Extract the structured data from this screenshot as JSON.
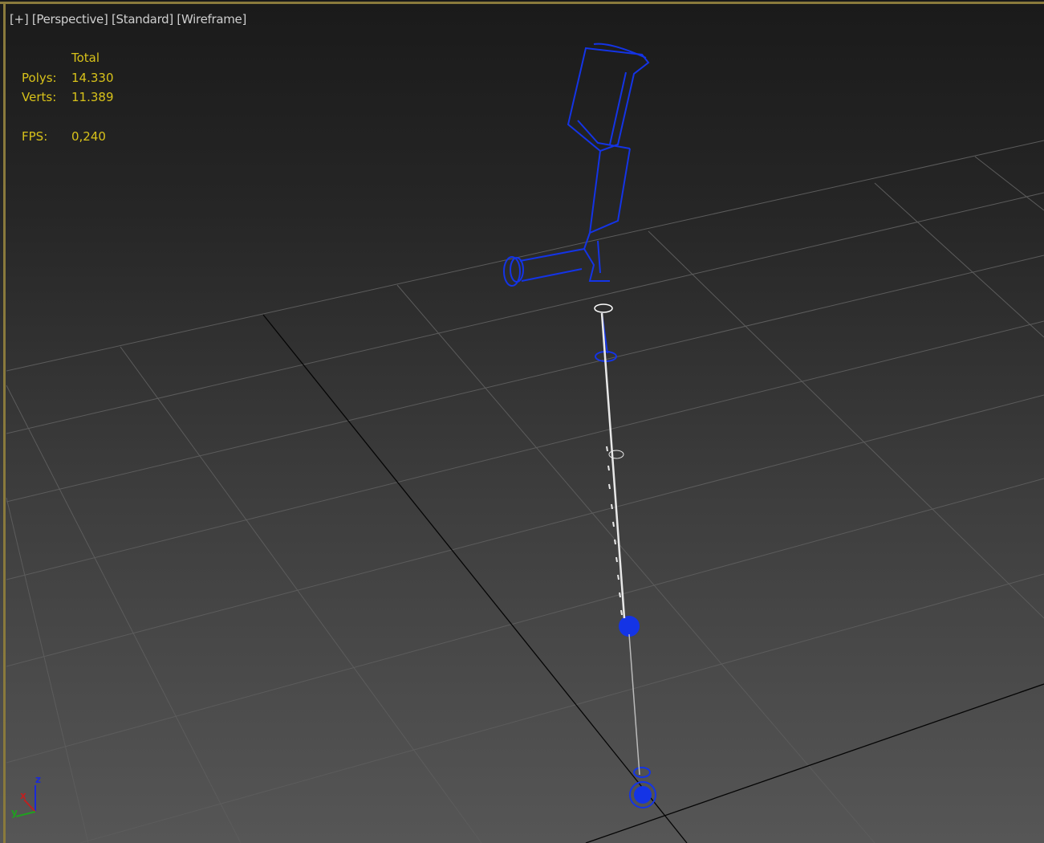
{
  "viewport": {
    "labels": [
      "[+]",
      "[Perspective]",
      "[Standard]",
      "[Wireframe]"
    ],
    "stats": {
      "header": "Total",
      "polys_label": "Polys:",
      "polys_value": "14.330",
      "verts_label": "Verts:",
      "verts_value": "11.389",
      "fps_label": "FPS:",
      "fps_value": "0,240"
    },
    "axis_gizmo": {
      "x": "x",
      "y": "y",
      "z": "z"
    },
    "colors": {
      "frame": "#8a7a3c",
      "stats": "#d8c21a",
      "wire": "#1030e0",
      "grid": "#5a5a5a"
    }
  }
}
